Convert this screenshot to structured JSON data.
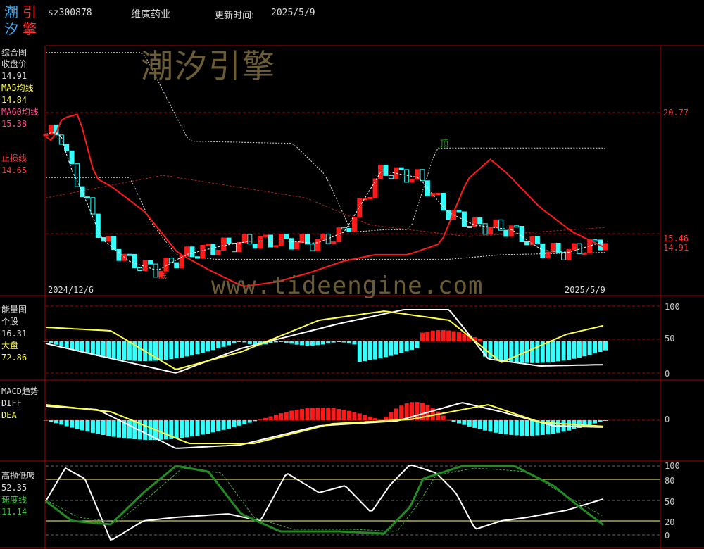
{
  "header": {
    "logo": [
      "潮",
      "引",
      "汐",
      "擎"
    ],
    "code": "sz300878",
    "name": "维康药业",
    "update_label": "更新时间:",
    "update_date": "2025/5/9"
  },
  "watermark": {
    "cn": "潮汐引擎",
    "url": "www.tideengine.com"
  },
  "colors": {
    "up": "#ff1a1a",
    "down": "#33ffff",
    "ma5": "#ffffff",
    "ma60": "#cc2222",
    "yellow": "#ffff44",
    "green": "#228b22",
    "grid": "#aa0000"
  },
  "panel1": {
    "title": "综合图",
    "close_label": "收盘价",
    "close_value": "14.91",
    "ma5_label": "MA5均线",
    "ma5_value": "14.84",
    "ma60_label": "MA60均线",
    "ma60_value": "15.38",
    "stop_label": "止损线",
    "stop_value": "14.65",
    "marker_top": "顶",
    "marker_bottom": "底",
    "date_start": "2024/12/6",
    "date_end": "2025/5/9",
    "right_high": "20.77",
    "right_mid": "15.46",
    "right_last": "14.91"
  },
  "panel2": {
    "title": "能量图",
    "stock_label": "个股",
    "stock_value": "16.31",
    "market_label": "大盘",
    "market_value": "72.86",
    "ticks": [
      "100",
      "50",
      "0"
    ]
  },
  "panel3": {
    "title": "MACD趋势",
    "diff_label": "DIFF",
    "dea_label": "DEA",
    "ticks": [
      "0"
    ]
  },
  "panel4": {
    "title": "高抛低吸",
    "value": "52.35",
    "speed_label": "速度线",
    "speed_value": "11.14",
    "ticks": [
      "100",
      "80",
      "50",
      "20",
      "0"
    ]
  },
  "chart_data": {
    "type": "candlestick",
    "n": 108,
    "price_ylim": [
      12.5,
      23.5
    ],
    "ma5_anchor": [
      [
        0,
        19.6
      ],
      [
        4,
        19.7
      ],
      [
        8,
        19.6
      ],
      [
        13,
        18.2
      ],
      [
        20,
        17.0
      ],
      [
        30,
        15.0
      ],
      [
        45,
        14.0
      ],
      [
        60,
        13.6
      ],
      [
        75,
        14.3
      ],
      [
        95,
        14.7
      ],
      [
        110,
        14.9
      ],
      [
        130,
        14.9
      ],
      [
        145,
        14.8
      ],
      [
        160,
        15.3
      ],
      [
        180,
        18.0
      ],
      [
        200,
        17.7
      ],
      [
        215,
        16.2
      ],
      [
        230,
        15.6
      ],
      [
        250,
        15.4
      ],
      [
        266,
        14.5
      ],
      [
        280,
        14.4
      ],
      [
        300,
        14.9
      ]
    ],
    "ma60_anchor": [
      [
        0,
        19.5
      ],
      [
        10,
        19.3
      ],
      [
        25,
        20.3
      ],
      [
        50,
        20.5
      ],
      [
        75,
        17.7
      ],
      [
        100,
        17.3
      ],
      [
        150,
        16.2
      ],
      [
        200,
        14.4
      ],
      [
        250,
        13.6
      ],
      [
        300,
        12.9
      ],
      [
        350,
        13.1
      ],
      [
        400,
        13.5
      ],
      [
        450,
        14.0
      ],
      [
        500,
        14.3
      ],
      [
        550,
        14.3
      ],
      [
        600,
        14.8
      ],
      [
        640,
        17.6
      ],
      [
        675,
        18.5
      ],
      [
        700,
        17.9
      ],
      [
        750,
        16.4
      ],
      [
        800,
        15.3
      ],
      [
        850,
        14.6
      ]
    ],
    "boll_upper_anchor": [
      [
        0,
        23.2
      ],
      [
        150,
        23.2
      ],
      [
        220,
        19.3
      ],
      [
        380,
        19.2
      ],
      [
        430,
        17.8
      ],
      [
        470,
        15.3
      ],
      [
        520,
        15.4
      ],
      [
        560,
        15.4
      ],
      [
        600,
        19.0
      ],
      [
        860,
        19.0
      ]
    ],
    "boll_lower_anchor": [
      [
        0,
        17.7
      ],
      [
        130,
        17.7
      ],
      [
        160,
        15.8
      ],
      [
        200,
        14.3
      ],
      [
        260,
        14.1
      ],
      [
        400,
        14.1
      ],
      [
        520,
        14.1
      ],
      [
        620,
        14.1
      ],
      [
        700,
        14.3
      ],
      [
        860,
        14.4
      ]
    ],
    "ma_long_anchor": [
      [
        0,
        16.8
      ],
      [
        180,
        17.8
      ],
      [
        400,
        16.8
      ],
      [
        500,
        15.6
      ],
      [
        650,
        15.1
      ],
      [
        860,
        15.5
      ]
    ]
  }
}
